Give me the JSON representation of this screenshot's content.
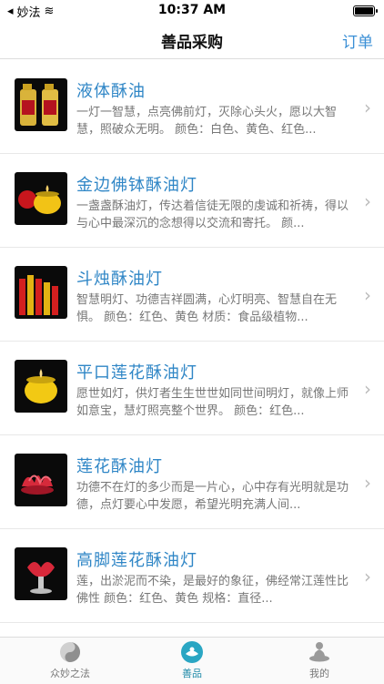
{
  "status": {
    "carrier": "妙法",
    "time": "10:37 AM"
  },
  "nav": {
    "title": "善品采购",
    "right_label": "订单"
  },
  "items": [
    {
      "title": "液体酥油",
      "desc": "一灯一智慧，点亮佛前灯，灭除心头火，愿以大智慧，照破众无明。 颜色：白色、黄色、红色..."
    },
    {
      "title": "金边佛钵酥油灯",
      "desc": "一盏盏酥油灯，传达着信徒无限的虔诚和祈祷，得以与心中最深沉的念想得以交流和寄托。 颜..."
    },
    {
      "title": "斗烛酥油灯",
      "desc": "智慧明灯、功德吉祥圆满，心灯明亮、智慧自在无惧。 颜色：红色、黄色 材质：食品级植物..."
    },
    {
      "title": "平口莲花酥油灯",
      "desc": "愿世如灯，供灯者生生世世如同世间明灯，就像上师如意宝，慧灯照亮整个世界。 颜色：红色..."
    },
    {
      "title": "莲花酥油灯",
      "desc": "功德不在灯的多少而是一片心，心中存有光明就是功德，点灯要心中发愿，希望光明充满人间..."
    },
    {
      "title": "高脚莲花酥油灯",
      "desc": "莲，出淤泥而不染，是最好的象征，佛经常江莲性比佛性 颜色：红色、黄色 规格：直径..."
    }
  ],
  "tabs": [
    {
      "label": "众妙之法",
      "icon": "yin-yang-icon"
    },
    {
      "label": "善品",
      "icon": "offering-icon"
    },
    {
      "label": "我的",
      "icon": "meditation-icon"
    }
  ],
  "colors": {
    "accent": "#2f86c6",
    "tab_active": "#1f8aa8"
  }
}
